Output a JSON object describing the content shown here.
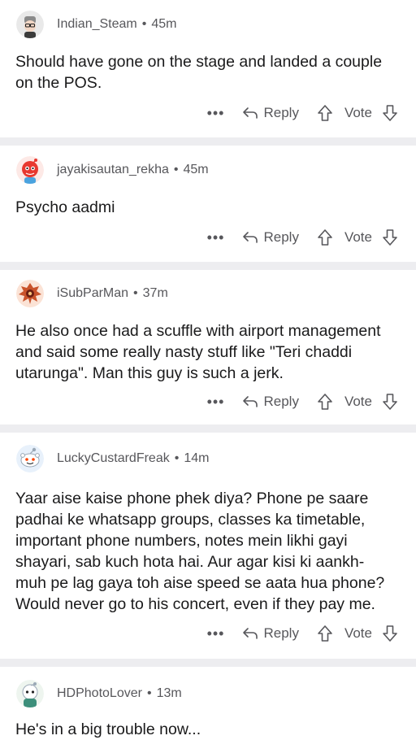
{
  "comments": [
    {
      "username": "Indian_Steam",
      "time": "45m",
      "body": "Should have gone on the stage and landed a couple on the POS.",
      "avatar": "avatar-grey-hair-glasses"
    },
    {
      "username": "jayakisautan_rekha",
      "time": "45m",
      "body": "Psycho aadmi",
      "avatar": "avatar-red-robot"
    },
    {
      "username": "iSubParMan",
      "time": "37m",
      "body": "He also once had a scuffle with airport management and said some really nasty stuff like \"Teri chaddi utarunga\". Man this guy is such a jerk.",
      "avatar": "avatar-demogorgon"
    },
    {
      "username": "LuckyCustardFreak",
      "time": "14m",
      "body": "Yaar aise kaise phone phek diya? Phone pe saare padhai ke whatsapp groups, classes ka timetable, important phone numbers, notes mein likhi gayi shayari, sab kuch hota hai. Aur agar kisi ki aankh-muh pe lag gaya toh aise speed se aata hua phone? Would never go to his concert, even if they pay me.",
      "avatar": "avatar-white-snoo"
    },
    {
      "username": "HDPhotoLover",
      "time": "13m",
      "body": "He's in a big trouble now...",
      "avatar": "avatar-green-snoo"
    }
  ],
  "actions": {
    "more": "•••",
    "reply": "Reply",
    "vote": "Vote"
  },
  "separator": "•",
  "colors": {
    "meta": "#57575b",
    "text": "#1a1a1b",
    "divider": "#ededf0"
  }
}
